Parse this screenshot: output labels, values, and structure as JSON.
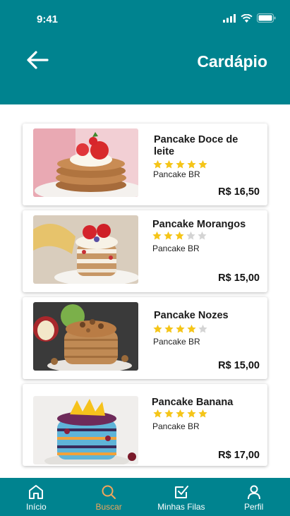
{
  "status": {
    "time": "9:41"
  },
  "header": {
    "title": "Cardápio"
  },
  "products": [
    {
      "name": "Pancake Doce de leite",
      "rating": 5,
      "brand": "Pancake BR",
      "price": "R$ 16,50"
    },
    {
      "name": "Pancake Morangos",
      "rating": 3,
      "brand": "Pancake BR",
      "price": "R$ 15,00"
    },
    {
      "name": "Pancake Nozes",
      "rating": 4,
      "brand": "Pancake BR",
      "price": "R$ 15,00"
    },
    {
      "name": "Pancake Banana",
      "rating": 5,
      "brand": "Pancake BR",
      "price": "R$ 17,00"
    }
  ],
  "nav": {
    "items": [
      {
        "label": "Início",
        "icon": "home-icon"
      },
      {
        "label": "Buscar",
        "icon": "search-icon"
      },
      {
        "label": "Minhas Filas",
        "icon": "checkbox-icon"
      },
      {
        "label": "Perfil",
        "icon": "user-icon"
      }
    ],
    "active": "Buscar"
  },
  "colors": {
    "primary": "#00838f",
    "accent": "#f3a65a",
    "star": "#f5c518",
    "star_empty": "#d4d4d4"
  }
}
